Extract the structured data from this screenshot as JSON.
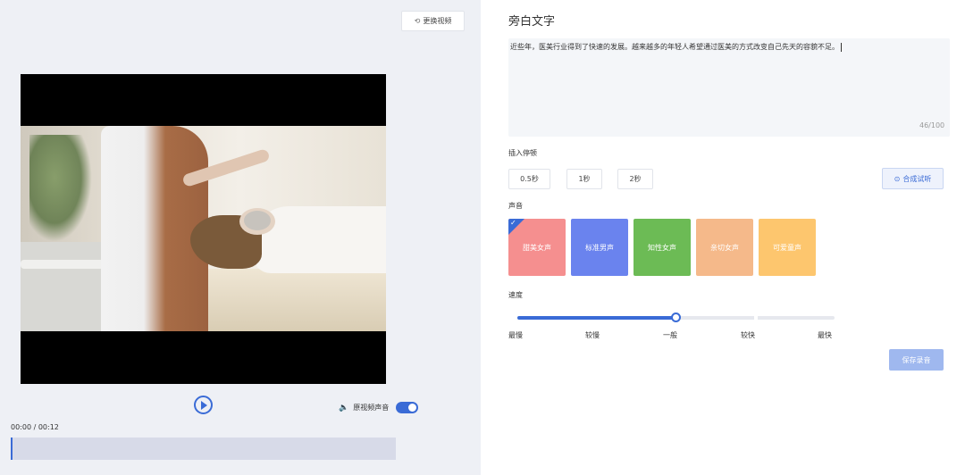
{
  "left": {
    "replace_video_label": "更换视频",
    "original_audio_label": "原视频声音",
    "time_display": "00:00 / 00:12"
  },
  "right": {
    "section_title": "旁白文字",
    "narration_text": "近些年，医美行业得到了快速的发展。越来越多的年轻人希望通过医美的方式改变自己先天的容貌不足。",
    "char_counter": "46/100",
    "insert_pause_label": "插入停顿",
    "pause_options": [
      "0.5秒",
      "1秒",
      "2秒"
    ],
    "synth_button_label": "合成试听",
    "voice_label": "声音",
    "voices": [
      {
        "label": "甜美女声",
        "color": "#f58f8f",
        "selected": true
      },
      {
        "label": "标准男声",
        "color": "#6a83ee",
        "selected": false
      },
      {
        "label": "知性女声",
        "color": "#6cbb55",
        "selected": false
      },
      {
        "label": "亲切女声",
        "color": "#f5b98a",
        "selected": false
      },
      {
        "label": "可爱童声",
        "color": "#fdc66e",
        "selected": false
      }
    ],
    "speed_label": "速度",
    "speed_levels": [
      "最慢",
      "较慢",
      "一般",
      "较快",
      "最快"
    ],
    "speed_selected_index": 2,
    "save_button_label": "保存录音"
  },
  "colors": {
    "accent": "#3a6bd6",
    "left_bg": "#eef0f5",
    "save_disabled": "#9fb8ef"
  }
}
